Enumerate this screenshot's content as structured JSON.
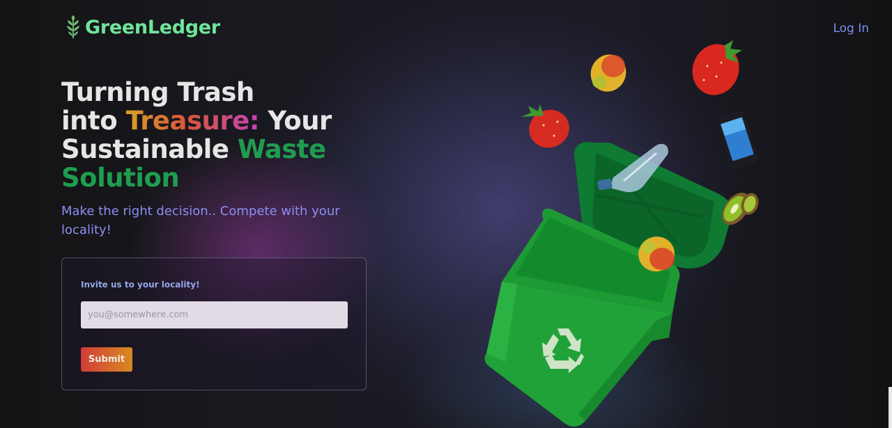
{
  "header": {
    "brand": "GreenLedger",
    "login_label": "Log In"
  },
  "hero": {
    "title_line1": "Turning Trash",
    "title_into": "into ",
    "title_treasure": "Treasure:",
    "title_your": " Your",
    "title_sustainable": "Sustainable ",
    "title_waste": "Waste",
    "title_solution": "Solution",
    "subtitle": "Make the right decision.. Compete with your locality!"
  },
  "invite_form": {
    "label": "Invite us to your locality!",
    "email_placeholder": "you@somewhere.com",
    "submit_label": "Submit"
  },
  "colors": {
    "brand_green": "#6fe49a",
    "accent_green": "#1f9d4f",
    "link_blue": "#7e8ef0",
    "submit_gradient_start": "#d23c3a",
    "submit_gradient_end": "#d68a22"
  },
  "illustration": {
    "items": [
      "mango-icon",
      "strawberry-icon",
      "smartphone-icon",
      "plastic-bottle-icon",
      "kiwi-icon",
      "recycle-bin-icon",
      "recycle-symbol-icon"
    ]
  }
}
